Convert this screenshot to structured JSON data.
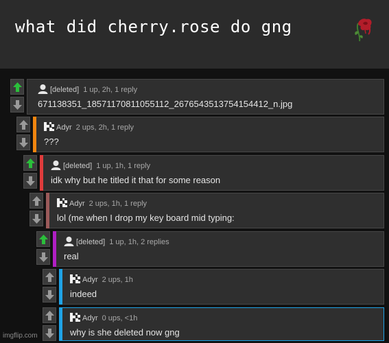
{
  "caption": "what did cherry.rose do gng",
  "watermark": "imgflip.com",
  "colors": {
    "upvoted": "#2bbf3b",
    "neutral": "#9a9a9a"
  },
  "comments": [
    {
      "user": "[deleted]",
      "avatar": "person-icon",
      "stats": "1 up, 2h, 1 reply",
      "text": "671138351_18571170811055112_2676543513754154412_n.jpg",
      "upvoted": true,
      "accent": ""
    },
    {
      "user": "Adyr",
      "avatar": "pixel-avatar-icon",
      "stats": "2 ups, 2h, 1 reply",
      "text": "???",
      "upvoted": false,
      "accent": "#f0850f"
    },
    {
      "user": "[deleted]",
      "avatar": "person-icon",
      "stats": "1 up, 1h, 1 reply",
      "text": "idk why but he titled it that for some reason",
      "upvoted": true,
      "accent": "#e03c3c"
    },
    {
      "user": "Adyr",
      "avatar": "pixel-avatar-icon",
      "stats": "2 ups, 1h, 1 reply",
      "text": "lol (me when I drop my key board mid typing:",
      "upvoted": false,
      "accent": "#9b5a5a"
    },
    {
      "user": "[deleted]",
      "avatar": "person-icon",
      "stats": "1 up, 1h, 2 replies",
      "text": "real",
      "upvoted": true,
      "accent": "#b01fc4"
    },
    {
      "user": "Adyr",
      "avatar": "pixel-avatar-icon",
      "stats": "2 ups, 1h",
      "text": "indeed",
      "upvoted": false,
      "accent": "#1fa3e6"
    },
    {
      "user": "Adyr",
      "avatar": "pixel-avatar-icon",
      "stats": "0 ups, <1h",
      "text": "why is she deleted now gng",
      "upvoted": false,
      "accent": "#1fa3e6"
    }
  ]
}
